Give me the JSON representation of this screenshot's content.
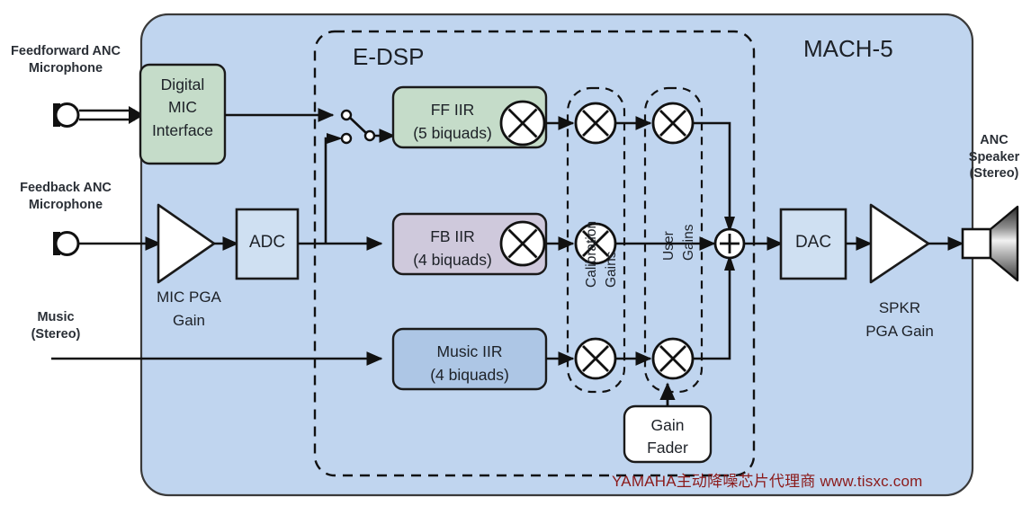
{
  "diagram": {
    "title": "MACH-5",
    "dsp_group_label": "E-DSP",
    "watermark": "YAMAHA主动降噪芯片代理商 www.tisxc.com"
  },
  "external_io": {
    "feedforward_mic": "Feedforward ANC\nMicrophone",
    "feedback_mic": "Feedback ANC\nMicrophone",
    "music_in": "Music\n(Stereo)",
    "anc_speaker": "ANC\nSpeaker\n(Stereo)"
  },
  "blocks": {
    "digital_mic_interface": "Digital\nMIC\nInterface",
    "adc": "ADC",
    "dac": "DAC",
    "ff_iir": "FF IIR\n(5 biquads)",
    "fb_iir": "FB IIR\n(4 biquads)",
    "music_iir": "Music IIR\n(4 biquads)",
    "gain_fader": "Gain\nFader"
  },
  "amplifiers": {
    "mic_pga": "MIC PGA\nGain",
    "spkr_pga": "SPKR\nPGA Gain"
  },
  "gain_groups": {
    "calibration": "Calibration\nGains",
    "user": "User\nGains"
  },
  "operators": {
    "multiply": "×",
    "sum": "+"
  },
  "colors": {
    "panel_bg": "#c0d5ef",
    "ff_iir_fill": "#c5dcc9",
    "fb_iir_fill": "#cfc9dc",
    "music_iir_fill": "#adc6e5",
    "converter_fill": "#cfe0f2",
    "white_fill": "#ffffff",
    "stroke": "#1a1a1a",
    "watermark_color": "#8b1a1a"
  }
}
